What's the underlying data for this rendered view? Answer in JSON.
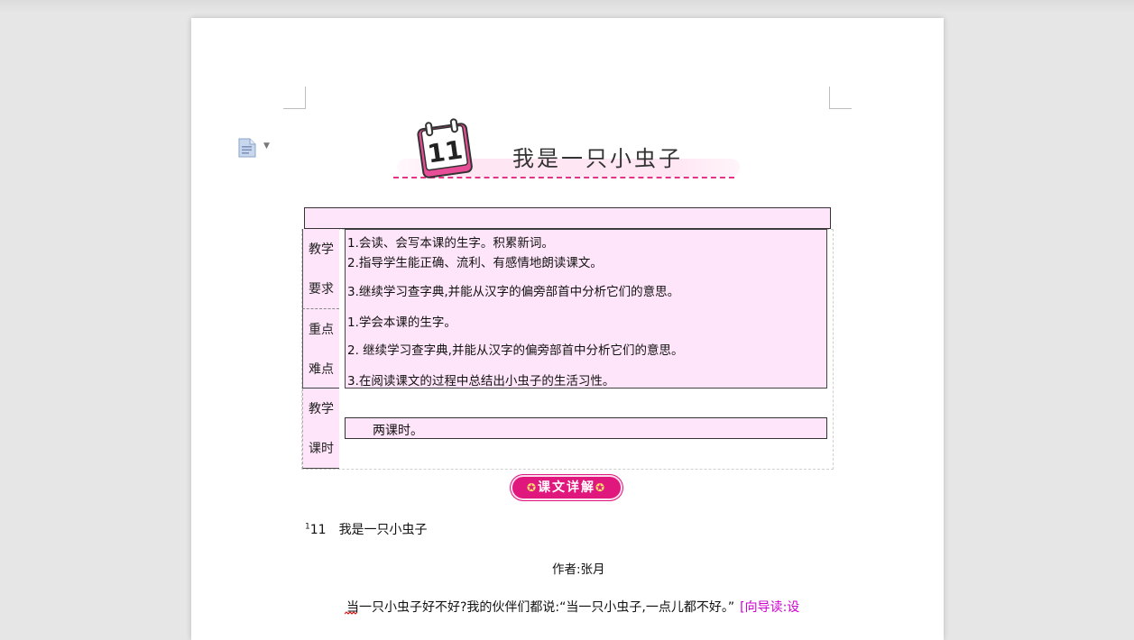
{
  "document": {
    "title": "我是一只小虫子",
    "calendar_number": "11",
    "table": {
      "rows": [
        {
          "label_top": "教学",
          "label_bottom": "要求",
          "lines": [
            "1.会读、会写本课的生字。积累新词。",
            "2.指导学生能正确、流利、有感情地朗读课文。",
            "3.继续学习查字典,并能从汉字的偏旁部首中分析它们的意思。"
          ]
        },
        {
          "label_top": "重点",
          "label_bottom": "难点",
          "lines": [
            "1.学会本课的生字。",
            "2.  继续学习查字典,并能从汉字的偏旁部首中分析它们的意思。",
            "3.在阅读课文的过程中总结出小虫子的生活习性。"
          ]
        },
        {
          "label_top": "教学",
          "label_bottom": "课时",
          "lines": [
            "两课时。"
          ]
        }
      ]
    },
    "section_badge": "课文详解",
    "heading_sup": "1",
    "heading_number": "11",
    "heading_title": "我是一只小虫子",
    "author": "作者:张月",
    "paragraph": "当一只小虫子好不好?我的伙伴们都说:“当一只小虫子,一点儿都不好。”",
    "paragraph_guide": "[向导读:设"
  },
  "colors": {
    "table_fill": "#ffe5f9",
    "accent_pink": "#e0187d",
    "guide_text": "#cc00cc"
  },
  "icons": {
    "doc_icon": "document-icon",
    "dropdown": "chevron-down-icon",
    "star": "star-icon"
  }
}
